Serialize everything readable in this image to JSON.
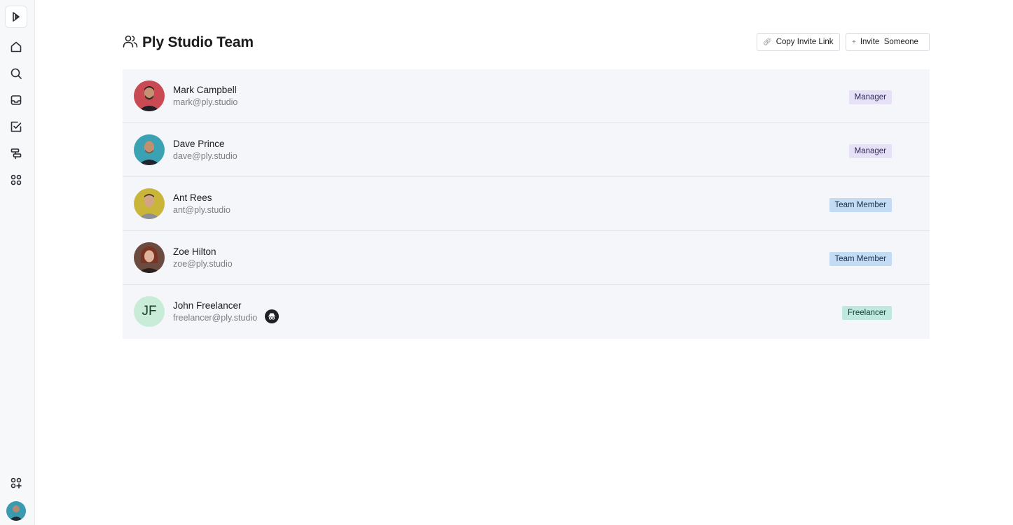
{
  "sidebar": {
    "items": [
      {
        "name": "logo",
        "icon": "play-logo-icon"
      },
      {
        "name": "home",
        "icon": "home-icon"
      },
      {
        "name": "search",
        "icon": "search-icon"
      },
      {
        "name": "inbox",
        "icon": "inbox-icon"
      },
      {
        "name": "tasks",
        "icon": "task-check-icon"
      },
      {
        "name": "workflows",
        "icon": "signpost-icon"
      },
      {
        "name": "apps",
        "icon": "apps-grid-icon"
      },
      {
        "name": "add-app",
        "icon": "add-apps-icon"
      }
    ]
  },
  "header": {
    "title": "Ply Studio Team",
    "copy_label": "Copy Invite Link",
    "invite_label": "Invite  Someone"
  },
  "members": [
    {
      "name": "Mark Campbell",
      "email": "mark@ply.studio",
      "role": "Manager",
      "role_type": "manager",
      "avatar_color": "#c94a52"
    },
    {
      "name": "Dave Prince",
      "email": "dave@ply.studio",
      "role": "Manager",
      "role_type": "manager",
      "avatar_color": "#3aa2b3"
    },
    {
      "name": "Ant Rees",
      "email": "ant@ply.studio",
      "role": "Team Member",
      "role_type": "member",
      "avatar_color": "#c9b53a"
    },
    {
      "name": "Zoe Hilton",
      "email": "zoe@ply.studio",
      "role": "Team Member",
      "role_type": "member",
      "avatar_color": "#6b4a40"
    },
    {
      "name": "John Freelancer",
      "email": "freelancer@ply.studio",
      "role": "Freelancer",
      "role_type": "freelancer",
      "initials": "JF",
      "avatar_color": "#c9ecd9"
    }
  ]
}
